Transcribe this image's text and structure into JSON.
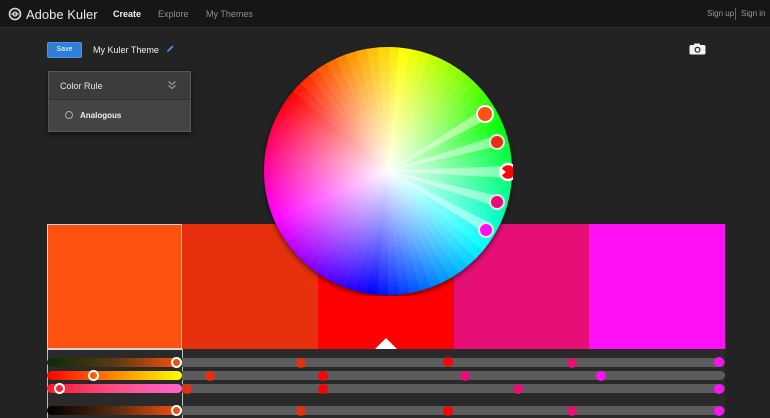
{
  "app": {
    "brand": "Adobe Kuler",
    "nav": [
      {
        "label": "Create",
        "active": true
      },
      {
        "label": "Explore",
        "active": false
      },
      {
        "label": "My Themes",
        "active": false
      }
    ],
    "auth": {
      "sign_up": "Sign up",
      "sign_in": "Sign in"
    },
    "icons": {
      "logo": "kuler-logo-icon",
      "edit": "pencil-icon",
      "capture": "camera-icon",
      "collapse": "double-chevron-down-icon"
    }
  },
  "toolbar": {
    "save_label": "Save",
    "theme_name": "My Kuler Theme"
  },
  "color_rule": {
    "title": "Color Rule",
    "option": "Analogous"
  },
  "theme": {
    "colors": [
      "#FF5210",
      "#E7300D",
      "#FF0000",
      "#E60F76",
      "#FF10F5"
    ],
    "selected_index": 0,
    "base_index": 2
  },
  "colors": {
    "accent": "#2F7FD9",
    "background": "#232323",
    "topbar": "#161616"
  }
}
